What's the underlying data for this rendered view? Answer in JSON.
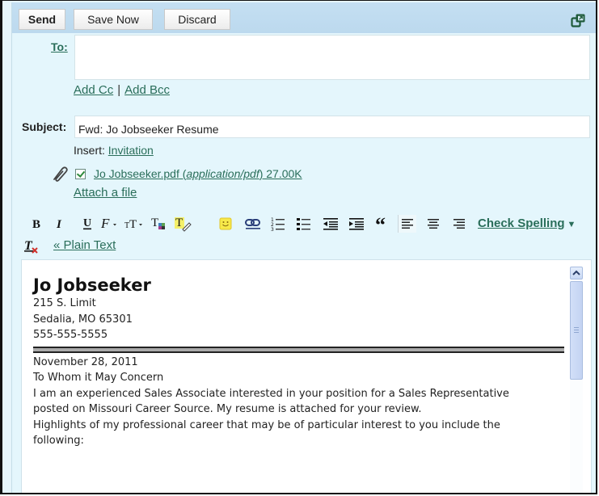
{
  "toolbar": {
    "send_label": "Send",
    "save_label": "Save Now",
    "discard_label": "Discard",
    "popout_icon": "popout-window-icon"
  },
  "recipients": {
    "to_label": "To:",
    "to_value": "",
    "add_cc_label": "Add Cc",
    "separator": "|",
    "add_bcc_label": "Add Bcc"
  },
  "subject": {
    "label": "Subject:",
    "value": "Fwd: Jo Jobseeker Resume"
  },
  "insert": {
    "label": "Insert:",
    "invitation_label": "Invitation"
  },
  "attachment": {
    "icon": "paperclip-icon",
    "checked": true,
    "filename": "Jo Jobseeker.pdf",
    "open_paren": " (",
    "mime_type": "application/pdf",
    "close_paren_size": ") 27.00K",
    "attach_file_label": "Attach a file"
  },
  "format_toolbar": {
    "buttons": [
      {
        "name": "bold",
        "icon": "bold-icon"
      },
      {
        "name": "italic",
        "icon": "italic-icon"
      },
      {
        "name": "underline",
        "icon": "underline-icon"
      },
      {
        "name": "font",
        "icon": "font-icon"
      },
      {
        "name": "size",
        "icon": "font-size-icon"
      },
      {
        "name": "text-color",
        "icon": "text-color-icon"
      },
      {
        "name": "highlight",
        "icon": "highlight-icon"
      },
      {
        "name": "emoticon",
        "icon": "smiley-icon"
      },
      {
        "name": "link",
        "icon": "link-icon"
      },
      {
        "name": "numbered-list",
        "icon": "numbered-list-icon"
      },
      {
        "name": "bulleted-list",
        "icon": "bulleted-list-icon"
      },
      {
        "name": "outdent",
        "icon": "outdent-icon"
      },
      {
        "name": "indent",
        "icon": "indent-icon"
      },
      {
        "name": "quote",
        "icon": "quote-icon"
      },
      {
        "name": "align-left",
        "icon": "align-left-icon"
      },
      {
        "name": "align-center",
        "icon": "align-center-icon"
      },
      {
        "name": "align-right",
        "icon": "align-right-icon"
      },
      {
        "name": "remove-formatting",
        "icon": "remove-formatting-icon"
      }
    ],
    "check_spelling_label": "Check Spelling",
    "check_spelling_arrow": "▼",
    "plain_text_label": "« Plain Text"
  },
  "body": {
    "name": "Jo Jobseeker",
    "address_lines": [
      "215 S. Limit",
      "Sedalia, MO 65301",
      "555-555-5555"
    ],
    "date": "November 28, 2011",
    "greeting": "To Whom it May Concern",
    "paragraph1_lines": [
      "I am an experienced Sales Associate interested in your position for a Sales Representative",
      "posted on Missouri Career Source. My resume is attached for your review."
    ],
    "paragraph2_lines": [
      "Highlights of my professional career that may be of particular interest to you include the",
      "following:"
    ]
  },
  "colors": {
    "link": "#2a6e5a",
    "panel_bg": "#e4f6fc",
    "topbar_bg": "#c4dff2"
  }
}
